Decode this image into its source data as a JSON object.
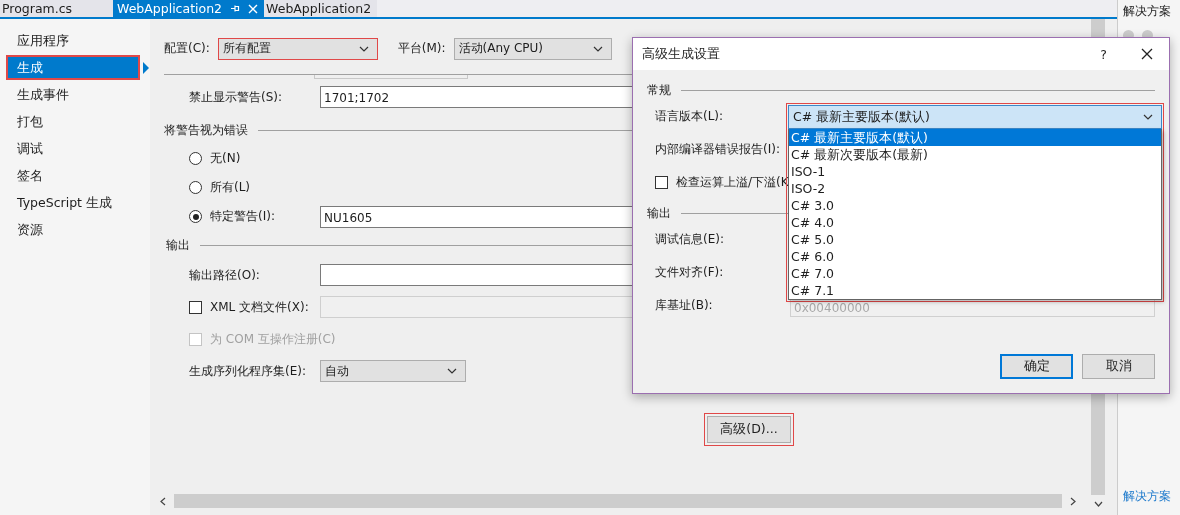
{
  "tabs": [
    {
      "label": "Program.cs",
      "selected": false,
      "pinned": false,
      "closable": false
    },
    {
      "label": "WebApplication2",
      "selected": true,
      "pinned": true,
      "closable": true
    },
    {
      "label": "WebApplication2",
      "selected": false,
      "pinned": false,
      "closable": false
    }
  ],
  "sidebar": {
    "items": [
      {
        "label": "应用程序",
        "selected": false
      },
      {
        "label": "生成",
        "selected": true
      },
      {
        "label": "生成事件",
        "selected": false
      },
      {
        "label": "打包",
        "selected": false
      },
      {
        "label": "调试",
        "selected": false
      },
      {
        "label": "签名",
        "selected": false
      },
      {
        "label": "TypeScript 生成",
        "selected": false
      },
      {
        "label": "资源",
        "selected": false
      }
    ]
  },
  "config_bar": {
    "configuration": {
      "label": "配置(C):",
      "value": "所有配置",
      "highlighted": true
    },
    "platform": {
      "label": "平台(M):",
      "value": "活动(Any CPU)",
      "highlighted": false
    }
  },
  "suppress_warnings": {
    "label": "禁止显示警告(S):",
    "value": "1701;1702"
  },
  "treat_warnings": {
    "title": "将警告视为错误",
    "options": [
      {
        "label": "无(N)",
        "selected": false
      },
      {
        "label": "所有(L)",
        "selected": false
      },
      {
        "label": "特定警告(I):",
        "selected": true,
        "value": "NU1605"
      }
    ]
  },
  "output": {
    "title": "输出",
    "path_label": "输出路径(O):",
    "xml_doc": {
      "label": "XML 文档文件(X):",
      "checked": false
    },
    "com_register": {
      "label": "为 COM 互操作注册(C)",
      "checked": false,
      "disabled": true
    },
    "serialization": {
      "label": "生成序列化程序集(E):",
      "value": "自动"
    }
  },
  "advanced_button": {
    "label": "高级(D)...",
    "highlighted": true
  },
  "right_panel": {
    "title": "解决方案",
    "footer": "解决方案"
  },
  "dialog": {
    "title": "高级生成设置",
    "help": "?",
    "general_title": "常规",
    "language_label": "语言版本(L):",
    "language_value": "C# 最新主要版本(默认)",
    "language_highlighted": true,
    "language_options": [
      {
        "label": "C# 最新主要版本(默认)",
        "selected": true
      },
      {
        "label": "C# 最新次要版本(最新)",
        "selected": false
      },
      {
        "label": "ISO-1",
        "selected": false
      },
      {
        "label": "ISO-2",
        "selected": false
      },
      {
        "label": "C# 3.0",
        "selected": false
      },
      {
        "label": "C# 4.0",
        "selected": false
      },
      {
        "label": "C# 5.0",
        "selected": false
      },
      {
        "label": "C# 6.0",
        "selected": false
      },
      {
        "label": "C# 7.0",
        "selected": false
      },
      {
        "label": "C# 7.1",
        "selected": false
      }
    ],
    "error_report_label": "内部编译器错误报告(I):",
    "overflow": {
      "label": "检查运算上溢/下溢(K",
      "checked": false
    },
    "output_title": "输出",
    "debug_label": "调试信息(E):",
    "alignment_label": "文件对齐(F):",
    "base_label": "库基址(B):",
    "base_value": "0x00400000",
    "ok": "确定",
    "cancel": "取消"
  }
}
